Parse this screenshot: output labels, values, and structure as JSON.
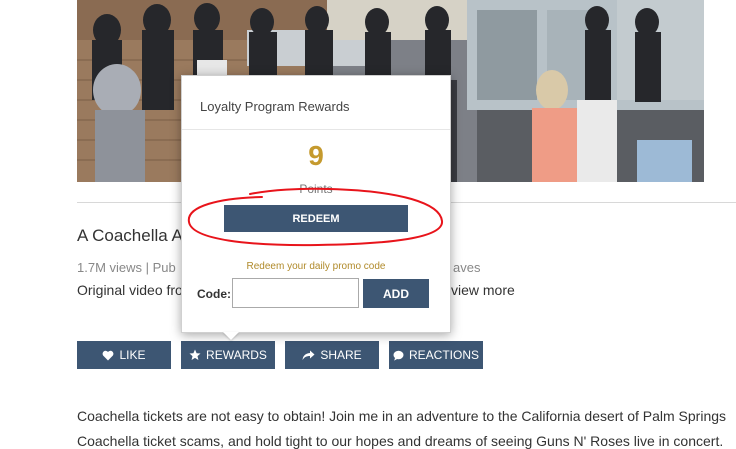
{
  "video": {
    "title_visible": "A Coachella A",
    "meta_left": "1.7M views | Pub",
    "meta_right": "aves",
    "description_short": "Original video fro",
    "view_more": "view more"
  },
  "actions": {
    "like": {
      "label": "LIKE",
      "icon": "heart-icon"
    },
    "rewards": {
      "label": "REWARDS",
      "icon": "star-icon"
    },
    "share": {
      "label": "SHARE",
      "icon": "share-arrow-icon"
    },
    "reactions": {
      "label": "REACTIONS",
      "icon": "chat-bubble-icon"
    }
  },
  "popup": {
    "title": "Loyalty Program Rewards",
    "points": "9",
    "points_label": "Points",
    "redeem_label": "REDEEM",
    "promo_text": "Redeem your daily promo code",
    "code_label": "Code:",
    "code_value": "",
    "code_placeholder": "",
    "add_label": "ADD"
  },
  "body_text": {
    "line1": "Coachella tickets are not easy to obtain! Join me in an adventure to the California desert of Palm Springs",
    "line2": "Coachella ticket scams, and hold tight to our hopes and dreams of seeing Guns N' Roses live in concert."
  },
  "colors": {
    "button": "#3d5673",
    "points": "#c59a2e",
    "annotation": "#e8141b"
  }
}
